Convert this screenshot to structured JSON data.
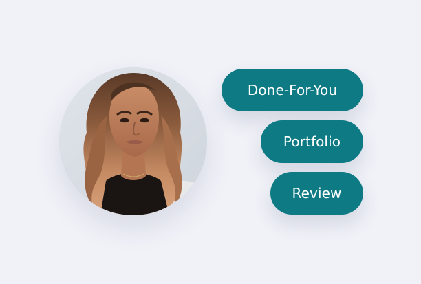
{
  "profile": {
    "avatar_icon": "portrait-photo"
  },
  "actions": [
    {
      "label": "Done-For-You"
    },
    {
      "label": "Portfolio"
    },
    {
      "label": "Review"
    }
  ],
  "colors": {
    "background": "#f1f2f8",
    "accent": "#0e7b84",
    "button_text": "#ffffff"
  }
}
